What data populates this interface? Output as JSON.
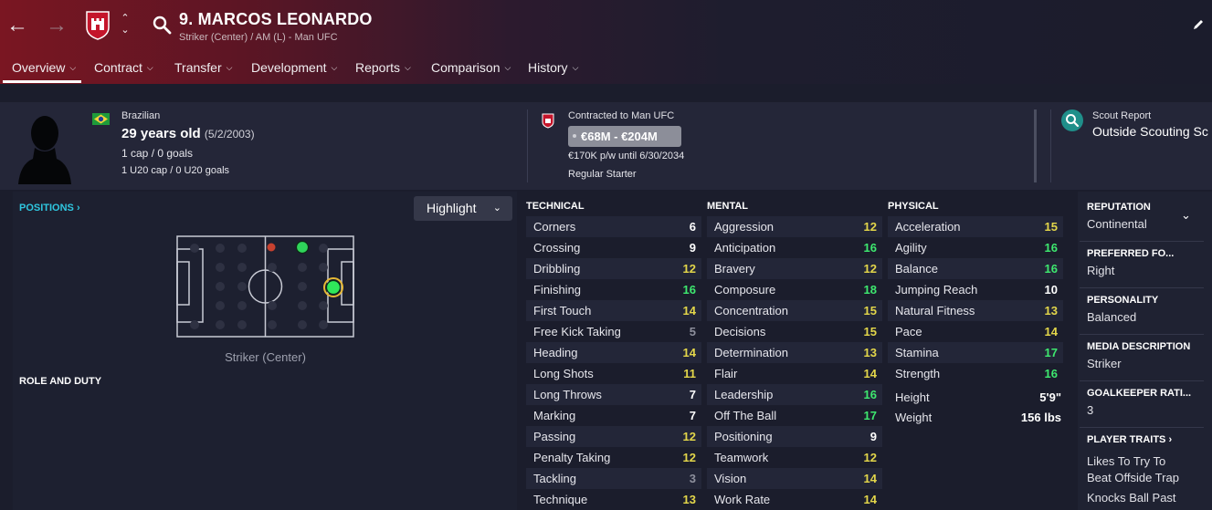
{
  "header": {
    "back_icon": "arrow-left-icon",
    "forward_icon": "arrow-right-icon",
    "player_name": "9. MARCOS LEONARDO",
    "player_subtitle": "Striker (Center) / AM (L) - Man UFC",
    "accent": "#7a1622"
  },
  "tabs": [
    {
      "label": "Overview"
    },
    {
      "label": "Contract"
    },
    {
      "label": "Transfer"
    },
    {
      "label": "Development"
    },
    {
      "label": "Reports"
    },
    {
      "label": "Comparison"
    },
    {
      "label": "History"
    }
  ],
  "info": {
    "nationality": "Brazilian",
    "age": "29 years old",
    "dob": "(5/2/2003)",
    "caps": "1 cap / 0 goals",
    "u20_caps": "1 U20 cap / 0 U20 goals",
    "contracted": "Contracted to Man UFC",
    "value": "€68M - €204M",
    "wage": "€170K p/w until 6/30/2034",
    "squad_status": "Regular Starter",
    "scout_label": "Scout Report",
    "scout_value": "Outside Scouting Sc"
  },
  "positions": {
    "title": "POSITIONS",
    "highlight_label": "Highlight",
    "pitch_label": "Striker (Center)",
    "role_title": "ROLE AND DUTY"
  },
  "colors": {
    "green": "#3ee86f",
    "yellow": "#e3d64a",
    "white": "#ffffff",
    "grey": "#8e909d"
  },
  "technical": {
    "title": "TECHNICAL",
    "attrs": [
      {
        "name": "Corners",
        "value": "6"
      },
      {
        "name": "Crossing",
        "value": "9"
      },
      {
        "name": "Dribbling",
        "value": "12"
      },
      {
        "name": "Finishing",
        "value": "16"
      },
      {
        "name": "First Touch",
        "value": "14"
      },
      {
        "name": "Free Kick Taking",
        "value": "5"
      },
      {
        "name": "Heading",
        "value": "14"
      },
      {
        "name": "Long Shots",
        "value": "11"
      },
      {
        "name": "Long Throws",
        "value": "7"
      },
      {
        "name": "Marking",
        "value": "7"
      },
      {
        "name": "Passing",
        "value": "12"
      },
      {
        "name": "Penalty Taking",
        "value": "12"
      },
      {
        "name": "Tackling",
        "value": "3"
      },
      {
        "name": "Technique",
        "value": "13"
      }
    ]
  },
  "mental": {
    "title": "MENTAL",
    "attrs": [
      {
        "name": "Aggression",
        "value": "12"
      },
      {
        "name": "Anticipation",
        "value": "16"
      },
      {
        "name": "Bravery",
        "value": "12"
      },
      {
        "name": "Composure",
        "value": "18"
      },
      {
        "name": "Concentration",
        "value": "15"
      },
      {
        "name": "Decisions",
        "value": "15"
      },
      {
        "name": "Determination",
        "value": "13"
      },
      {
        "name": "Flair",
        "value": "14"
      },
      {
        "name": "Leadership",
        "value": "16"
      },
      {
        "name": "Off The Ball",
        "value": "17"
      },
      {
        "name": "Positioning",
        "value": "9"
      },
      {
        "name": "Teamwork",
        "value": "12"
      },
      {
        "name": "Vision",
        "value": "14"
      },
      {
        "name": "Work Rate",
        "value": "14"
      }
    ]
  },
  "physical": {
    "title": "PHYSICAL",
    "attrs": [
      {
        "name": "Acceleration",
        "value": "15"
      },
      {
        "name": "Agility",
        "value": "16"
      },
      {
        "name": "Balance",
        "value": "16"
      },
      {
        "name": "Jumping Reach",
        "value": "10"
      },
      {
        "name": "Natural Fitness",
        "value": "13"
      },
      {
        "name": "Pace",
        "value": "14"
      },
      {
        "name": "Stamina",
        "value": "17"
      },
      {
        "name": "Strength",
        "value": "16"
      }
    ],
    "height_label": "Height",
    "height": "5'9\"",
    "weight_label": "Weight",
    "weight": "156 lbs"
  },
  "sidebar": {
    "reputation_title": "REPUTATION",
    "reputation": "Continental",
    "foot_title": "PREFERRED FO...",
    "foot": "Right",
    "personality_title": "PERSONALITY",
    "personality": "Balanced",
    "media_title": "MEDIA DESCRIPTION",
    "media": "Striker",
    "gk_title": "GOALKEEPER RATI...",
    "gk": "3",
    "traits_title": "PLAYER TRAITS",
    "traits": [
      "Likes To Try To",
      "Beat Offside Trap",
      "Knocks Ball Past"
    ]
  }
}
